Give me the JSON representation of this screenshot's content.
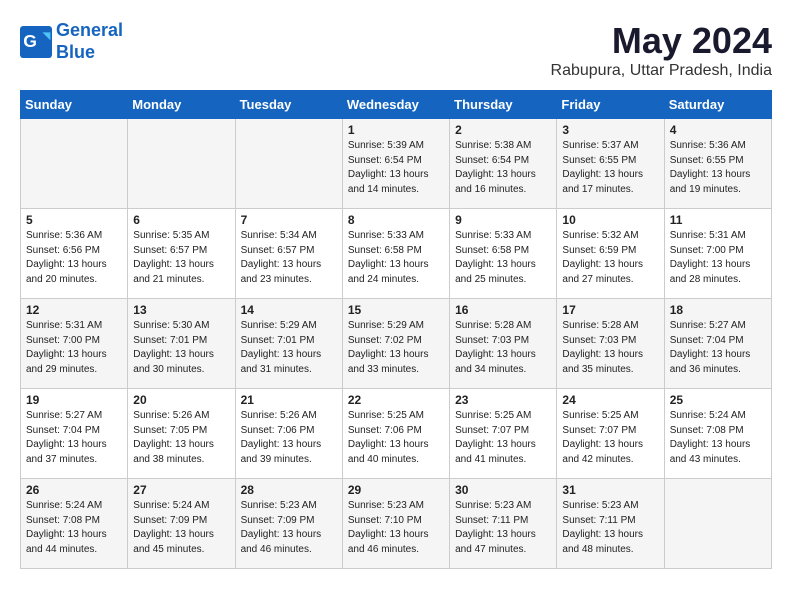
{
  "header": {
    "logo_line1": "General",
    "logo_line2": "Blue",
    "title": "May 2024",
    "subtitle": "Rabupura, Uttar Pradesh, India"
  },
  "weekdays": [
    "Sunday",
    "Monday",
    "Tuesday",
    "Wednesday",
    "Thursday",
    "Friday",
    "Saturday"
  ],
  "weeks": [
    [
      {
        "day": "",
        "info": ""
      },
      {
        "day": "",
        "info": ""
      },
      {
        "day": "",
        "info": ""
      },
      {
        "day": "1",
        "info": "Sunrise: 5:39 AM\nSunset: 6:54 PM\nDaylight: 13 hours\nand 14 minutes."
      },
      {
        "day": "2",
        "info": "Sunrise: 5:38 AM\nSunset: 6:54 PM\nDaylight: 13 hours\nand 16 minutes."
      },
      {
        "day": "3",
        "info": "Sunrise: 5:37 AM\nSunset: 6:55 PM\nDaylight: 13 hours\nand 17 minutes."
      },
      {
        "day": "4",
        "info": "Sunrise: 5:36 AM\nSunset: 6:55 PM\nDaylight: 13 hours\nand 19 minutes."
      }
    ],
    [
      {
        "day": "5",
        "info": "Sunrise: 5:36 AM\nSunset: 6:56 PM\nDaylight: 13 hours\nand 20 minutes."
      },
      {
        "day": "6",
        "info": "Sunrise: 5:35 AM\nSunset: 6:57 PM\nDaylight: 13 hours\nand 21 minutes."
      },
      {
        "day": "7",
        "info": "Sunrise: 5:34 AM\nSunset: 6:57 PM\nDaylight: 13 hours\nand 23 minutes."
      },
      {
        "day": "8",
        "info": "Sunrise: 5:33 AM\nSunset: 6:58 PM\nDaylight: 13 hours\nand 24 minutes."
      },
      {
        "day": "9",
        "info": "Sunrise: 5:33 AM\nSunset: 6:58 PM\nDaylight: 13 hours\nand 25 minutes."
      },
      {
        "day": "10",
        "info": "Sunrise: 5:32 AM\nSunset: 6:59 PM\nDaylight: 13 hours\nand 27 minutes."
      },
      {
        "day": "11",
        "info": "Sunrise: 5:31 AM\nSunset: 7:00 PM\nDaylight: 13 hours\nand 28 minutes."
      }
    ],
    [
      {
        "day": "12",
        "info": "Sunrise: 5:31 AM\nSunset: 7:00 PM\nDaylight: 13 hours\nand 29 minutes."
      },
      {
        "day": "13",
        "info": "Sunrise: 5:30 AM\nSunset: 7:01 PM\nDaylight: 13 hours\nand 30 minutes."
      },
      {
        "day": "14",
        "info": "Sunrise: 5:29 AM\nSunset: 7:01 PM\nDaylight: 13 hours\nand 31 minutes."
      },
      {
        "day": "15",
        "info": "Sunrise: 5:29 AM\nSunset: 7:02 PM\nDaylight: 13 hours\nand 33 minutes."
      },
      {
        "day": "16",
        "info": "Sunrise: 5:28 AM\nSunset: 7:03 PM\nDaylight: 13 hours\nand 34 minutes."
      },
      {
        "day": "17",
        "info": "Sunrise: 5:28 AM\nSunset: 7:03 PM\nDaylight: 13 hours\nand 35 minutes."
      },
      {
        "day": "18",
        "info": "Sunrise: 5:27 AM\nSunset: 7:04 PM\nDaylight: 13 hours\nand 36 minutes."
      }
    ],
    [
      {
        "day": "19",
        "info": "Sunrise: 5:27 AM\nSunset: 7:04 PM\nDaylight: 13 hours\nand 37 minutes."
      },
      {
        "day": "20",
        "info": "Sunrise: 5:26 AM\nSunset: 7:05 PM\nDaylight: 13 hours\nand 38 minutes."
      },
      {
        "day": "21",
        "info": "Sunrise: 5:26 AM\nSunset: 7:06 PM\nDaylight: 13 hours\nand 39 minutes."
      },
      {
        "day": "22",
        "info": "Sunrise: 5:25 AM\nSunset: 7:06 PM\nDaylight: 13 hours\nand 40 minutes."
      },
      {
        "day": "23",
        "info": "Sunrise: 5:25 AM\nSunset: 7:07 PM\nDaylight: 13 hours\nand 41 minutes."
      },
      {
        "day": "24",
        "info": "Sunrise: 5:25 AM\nSunset: 7:07 PM\nDaylight: 13 hours\nand 42 minutes."
      },
      {
        "day": "25",
        "info": "Sunrise: 5:24 AM\nSunset: 7:08 PM\nDaylight: 13 hours\nand 43 minutes."
      }
    ],
    [
      {
        "day": "26",
        "info": "Sunrise: 5:24 AM\nSunset: 7:08 PM\nDaylight: 13 hours\nand 44 minutes."
      },
      {
        "day": "27",
        "info": "Sunrise: 5:24 AM\nSunset: 7:09 PM\nDaylight: 13 hours\nand 45 minutes."
      },
      {
        "day": "28",
        "info": "Sunrise: 5:23 AM\nSunset: 7:09 PM\nDaylight: 13 hours\nand 46 minutes."
      },
      {
        "day": "29",
        "info": "Sunrise: 5:23 AM\nSunset: 7:10 PM\nDaylight: 13 hours\nand 46 minutes."
      },
      {
        "day": "30",
        "info": "Sunrise: 5:23 AM\nSunset: 7:11 PM\nDaylight: 13 hours\nand 47 minutes."
      },
      {
        "day": "31",
        "info": "Sunrise: 5:23 AM\nSunset: 7:11 PM\nDaylight: 13 hours\nand 48 minutes."
      },
      {
        "day": "",
        "info": ""
      }
    ]
  ]
}
